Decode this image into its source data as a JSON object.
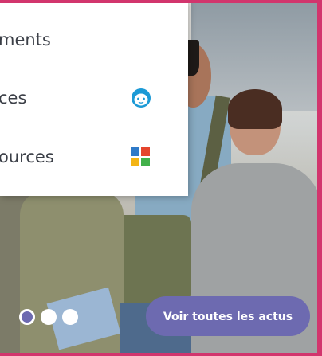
{
  "menu": {
    "items": [
      {
        "label": "ments",
        "icon": ""
      },
      {
        "label": "ces",
        "icon": "child-face-icon"
      },
      {
        "label": "ources",
        "icon": "colored-grid-icon"
      }
    ]
  },
  "carousel": {
    "slide_count": 3,
    "active_index": 0,
    "cta_label": "Voir toutes les actus"
  },
  "colors": {
    "frame": "#d2356d",
    "accent": "#6d6ab0",
    "face_icon": "#1c9ad6",
    "grid_red": "#e5452d",
    "grid_blue": "#2f7ac8",
    "grid_green": "#42b04a",
    "grid_yellow": "#f3b415"
  }
}
